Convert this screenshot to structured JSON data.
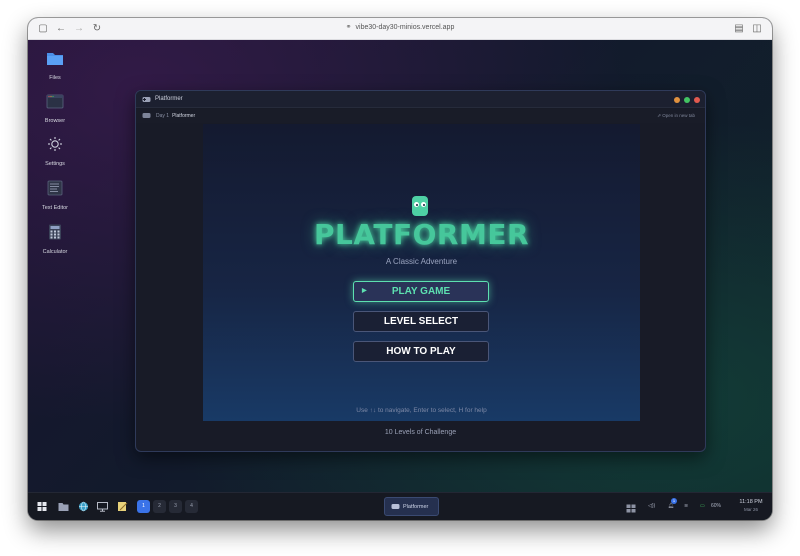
{
  "browser": {
    "url": "vibe30-day30-minios.vercel.app"
  },
  "desktop_icons": [
    {
      "label": "Files",
      "icon": "folder-icon"
    },
    {
      "label": "Browser",
      "icon": "browser-icon"
    },
    {
      "label": "Settings",
      "icon": "gear-icon"
    },
    {
      "label": "Text Editor",
      "icon": "text-editor-icon"
    },
    {
      "label": "Calculator",
      "icon": "calculator-icon"
    }
  ],
  "window": {
    "title": "Platformer",
    "crumb_day": "Day 1",
    "crumb_app": "Platformer",
    "open_new_tab": "Open in new tab",
    "footer": "10 Levels of Challenge"
  },
  "game": {
    "title": "PLATFORMER",
    "subtitle": "A Classic Adventure",
    "menu": [
      "PLAY GAME",
      "LEVEL SELECT",
      "HOW TO PLAY"
    ],
    "hint": "Use ↑↓ to navigate, Enter to select, H for help"
  },
  "taskbar": {
    "workspaces": [
      "1",
      "2",
      "3",
      "4"
    ],
    "active_task": "Platformer",
    "battery": "60%",
    "notifications": "1",
    "time": "11:18 PM",
    "date": "Mar 26"
  },
  "colors": {
    "accent": "#5de0b0",
    "workspace_active": "#3a73e8",
    "traffic_close": "#e25a4f",
    "traffic_max": "#43c463",
    "traffic_min": "#e0913f"
  }
}
